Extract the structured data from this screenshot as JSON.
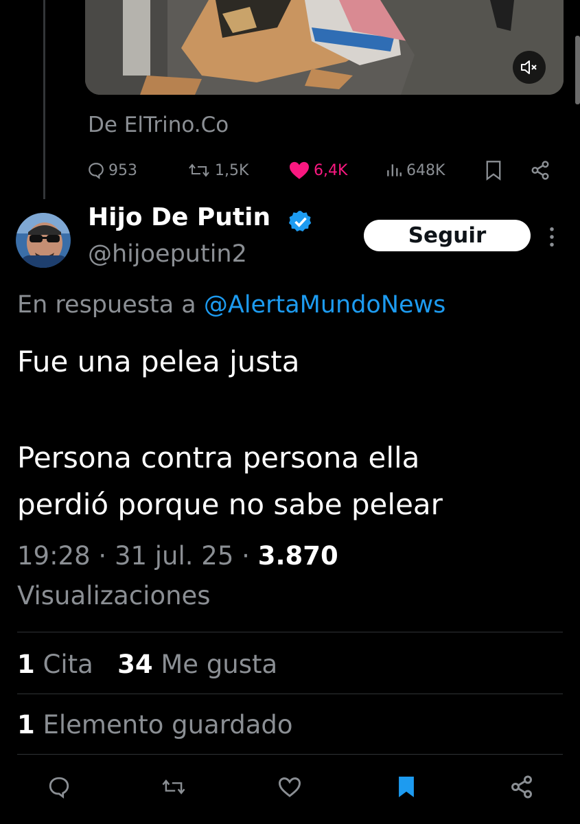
{
  "colors": {
    "background": "#000000",
    "text": "#e7e9ea",
    "muted": "#8b8f94",
    "accent": "#1d9bf0",
    "like": "#f91880"
  },
  "quoted": {
    "source": "De ElTrino.Co",
    "metrics": {
      "replies": "953",
      "reposts": "1,5K",
      "likes": "6,4K",
      "views": "648K"
    },
    "media_mute_icon": "muted-speaker-icon"
  },
  "tweet": {
    "author_name": "Hijo De Putin",
    "author_handle": "@hijoeputin2",
    "follow_label": "Seguir",
    "reply_prefix": "En respuesta a",
    "reply_to": "@AlertaMundoNews",
    "text_lines": [
      "Fue una pelea justa",
      "Persona contra persona ella",
      "perdió porque no sabe pelear"
    ],
    "time": "19:28",
    "date": "31 jul. 25",
    "views_count": "3.870",
    "views_label": "Visualizaciones",
    "quotes_count": "1",
    "quotes_label": "Cita",
    "likes_count": "34",
    "likes_label": "Me gusta",
    "bookmarks_count": "1",
    "bookmarks_label": "Elemento guardado"
  },
  "actions": [
    "reply-icon",
    "repost-icon",
    "like-icon",
    "bookmark-icon",
    "share-icon"
  ]
}
